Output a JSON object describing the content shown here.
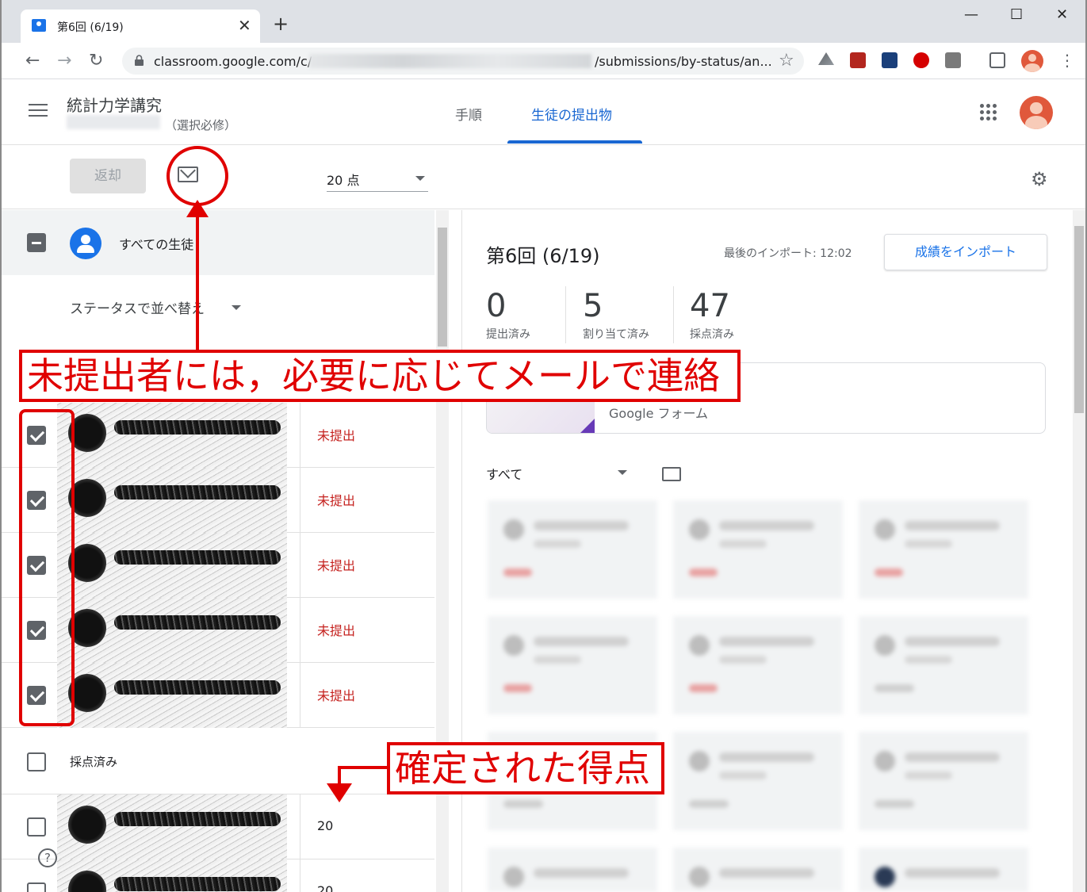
{
  "browser": {
    "tab_title": "第6回 (6/19)",
    "tab_close": "✕",
    "new_tab": "+",
    "win_min": "—",
    "win_max": "☐",
    "win_close": "✕",
    "url_prefix": "classroom.google.com/c/",
    "url_suffix": "/submissions/by-status/an...",
    "back": "←",
    "forward": "→",
    "reload": "↻",
    "star": "☆"
  },
  "header": {
    "course_title": "統計力学講究",
    "section": "（選択必修）",
    "tabs": [
      {
        "label": "手順"
      },
      {
        "label": "生徒の提出物"
      }
    ]
  },
  "actionbar": {
    "return_label": "返却",
    "points_value": "20 点"
  },
  "left": {
    "all_students": "すべての生徒",
    "sort_label": "ステータスで並べ替え",
    "unsubmitted_rows": [
      {
        "status": "未提出"
      },
      {
        "status": "未提出"
      },
      {
        "status": "未提出"
      },
      {
        "status": "未提出"
      },
      {
        "status": "未提出"
      }
    ],
    "graded_header": "採点済み",
    "graded_rows": [
      {
        "score": "20"
      },
      {
        "score": "20"
      }
    ],
    "help": "?"
  },
  "right": {
    "assignment_title": "第6回 (6/19)",
    "last_import": "最後のインポート: 12:02",
    "import_button": "成績をインポート",
    "stats": [
      {
        "num": "0",
        "label": "提出済み"
      },
      {
        "num": "5",
        "label": "割り当て済み"
      },
      {
        "num": "47",
        "label": "採点済み"
      }
    ],
    "attachment_label": "Google フォーム",
    "filter_label": "すべて"
  },
  "annotations": {
    "note1": "未提出者には，必要に応じてメールで連絡",
    "note2": "確定された得点"
  },
  "colors": {
    "accent": "#1967d2",
    "annotation_red": "#e00000",
    "unsubmitted_red": "#c5221f"
  }
}
